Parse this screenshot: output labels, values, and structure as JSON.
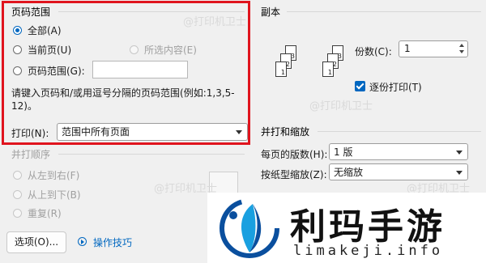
{
  "page_range": {
    "title": "页码范围",
    "all_label": "全部(A)",
    "current_label": "当前页(U)",
    "selection_label": "所选内容(E)",
    "pages_label": "页码范围(G):",
    "pages_value": "",
    "hint": "请键入页码和/或用逗号分隔的页码范围(例如:1,3,5-12)。"
  },
  "print_what": {
    "label": "打印(N):",
    "value": "范围中所有页面"
  },
  "copies": {
    "title": "副本",
    "count_label": "份数(C):",
    "count_value": "1",
    "collate_label": "逐份打印(T)"
  },
  "zoom": {
    "title": "并打和缩放",
    "pages_per_sheet_label": "每页的版数(H):",
    "pages_per_sheet_value": "1 版",
    "scale_label": "按纸型缩放(Z):",
    "scale_value": "无缩放"
  },
  "print_order": {
    "title": "并打顺序",
    "ltr_label": "从左到右(F)",
    "ttb_label": "从上到下(B)",
    "repeat_label": "重复(R)"
  },
  "footer": {
    "options_button": "选项(O)...",
    "tips_link": "操作技巧"
  },
  "overlay": {
    "brand_name": "利玛手游",
    "brand_url": "limakeji.info",
    "watermark": "@打印机卫士"
  },
  "colors": {
    "accent": "#0067c0",
    "highlight_frame": "#e0141e"
  }
}
